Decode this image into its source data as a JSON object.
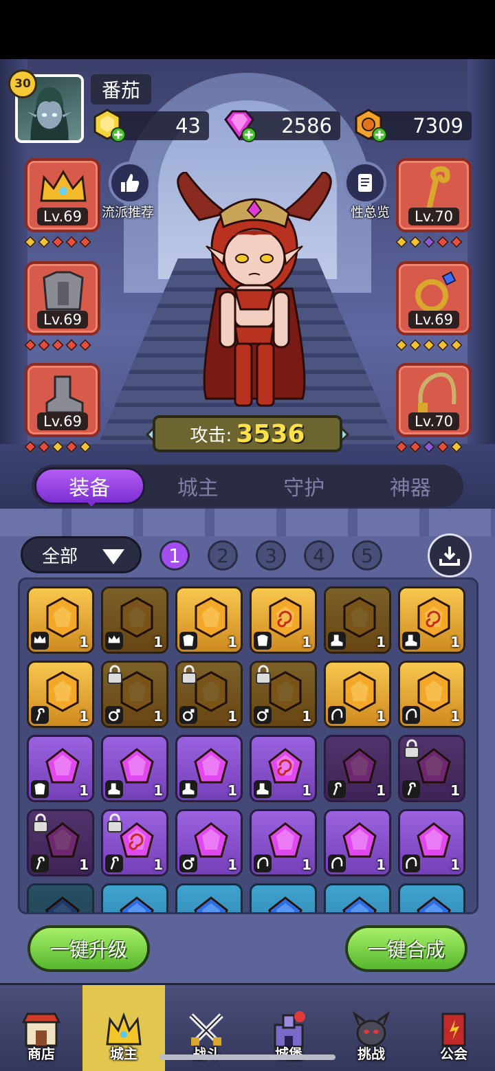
{
  "player": {
    "level": "30",
    "name": "番茄"
  },
  "resources": [
    {
      "name": "gold-hex-currency",
      "value": "43",
      "color": "#f4d33c"
    },
    {
      "name": "pink-gem-currency",
      "value": "2586",
      "color": "#e03ad7"
    },
    {
      "name": "orange-coin-currency",
      "value": "7309",
      "color": "#f0a22a"
    }
  ],
  "slots": {
    "left": [
      {
        "icon": "crown-icon",
        "level": "Lv.69",
        "dots": [
          "#f1c232",
          "#f1c232",
          "#e74c3c",
          "#e74c3c",
          "#e74c3c"
        ]
      },
      {
        "icon": "armor-icon",
        "level": "Lv.69",
        "dots": [
          "#e74c3c",
          "#e74c3c",
          "#e74c3c",
          "#e74c3c",
          "#e74c3c"
        ]
      },
      {
        "icon": "boot-icon",
        "level": "Lv.69",
        "dots": [
          "#e74c3c",
          "#e74c3c",
          "#f1c232",
          "#e74c3c",
          "#f1c232"
        ]
      }
    ],
    "right": [
      {
        "icon": "staff-icon",
        "level": "Lv.70",
        "dots": [
          "#f1c232",
          "#f1c232",
          "#8a5ad6",
          "#e74c3c",
          "#e74c3c"
        ]
      },
      {
        "icon": "ring-icon",
        "level": "Lv.69",
        "dots": [
          "#f1c232",
          "#f1c232",
          "#f1c232",
          "#f1c232",
          "#f1c232"
        ]
      },
      {
        "icon": "whip-icon",
        "level": "Lv.70",
        "dots": [
          "#e74c3c",
          "#e74c3c",
          "#8a5ad6",
          "#e74c3c",
          "#f1c232"
        ]
      }
    ]
  },
  "buttons": {
    "recommend": "流派推荐",
    "overview": "性总览",
    "upgrade_all": "一键升级",
    "merge_all": "一键合成"
  },
  "attack": {
    "label": "攻击:",
    "value": "3536"
  },
  "tabs": [
    "装备",
    "城主",
    "守护",
    "神器"
  ],
  "filter": {
    "label": "全部"
  },
  "pages": [
    "1",
    "2",
    "3",
    "4",
    "5"
  ],
  "grid": [
    [
      {
        "c": "gold",
        "t": "crown",
        "n": "1"
      },
      {
        "c": "gold",
        "t": "crown",
        "n": "1",
        "dim": true
      },
      {
        "c": "gold",
        "t": "armor",
        "n": "1"
      },
      {
        "c": "gold",
        "t": "armor",
        "n": "1",
        "swirl": true
      },
      {
        "c": "gold",
        "t": "boot",
        "n": "1",
        "dim": true
      },
      {
        "c": "gold",
        "t": "boot",
        "n": "1",
        "swirl": true
      }
    ],
    [
      {
        "c": "gold",
        "t": "staff",
        "n": "1"
      },
      {
        "c": "gold",
        "t": "ring",
        "n": "1",
        "dim": true,
        "lock": true
      },
      {
        "c": "gold",
        "t": "ring",
        "n": "1",
        "dim": true,
        "lock": true
      },
      {
        "c": "gold",
        "t": "ring",
        "n": "1",
        "dim": true,
        "lock": true
      },
      {
        "c": "gold",
        "t": "whip",
        "n": "1"
      },
      {
        "c": "gold",
        "t": "whip",
        "n": "1"
      }
    ],
    [
      {
        "c": "purple",
        "t": "armor",
        "n": "1"
      },
      {
        "c": "purple",
        "t": "boot",
        "n": "1"
      },
      {
        "c": "purple",
        "t": "boot",
        "n": "1"
      },
      {
        "c": "purple",
        "t": "boot",
        "n": "1",
        "swirl": true
      },
      {
        "c": "purple",
        "t": "staff",
        "n": "1",
        "dim": true
      },
      {
        "c": "purple",
        "t": "staff",
        "n": "1",
        "dim": true,
        "lock": true
      }
    ],
    [
      {
        "c": "purple",
        "t": "staff",
        "n": "1",
        "dim": true,
        "lock": true
      },
      {
        "c": "purple",
        "t": "staff",
        "n": "1",
        "lock": true,
        "swirl": true
      },
      {
        "c": "purple",
        "t": "ring",
        "n": "1"
      },
      {
        "c": "purple",
        "t": "whip",
        "n": "1"
      },
      {
        "c": "purple",
        "t": "whip",
        "n": "1"
      },
      {
        "c": "purple",
        "t": "whip",
        "n": "1"
      }
    ],
    [
      {
        "c": "blue",
        "t": "",
        "n": "",
        "dim": true
      },
      {
        "c": "blue",
        "t": "",
        "n": ""
      },
      {
        "c": "blue",
        "t": "",
        "n": ""
      },
      {
        "c": "blue",
        "t": "",
        "n": ""
      },
      {
        "c": "blue",
        "t": "",
        "n": ""
      },
      {
        "c": "blue",
        "t": "",
        "n": ""
      }
    ]
  ],
  "nav": [
    {
      "label": "商店",
      "icon": "shop-icon"
    },
    {
      "label": "城主",
      "icon": "crown-icon",
      "active": true
    },
    {
      "label": "战斗",
      "icon": "swords-icon"
    },
    {
      "label": "城堡",
      "icon": "castle-icon"
    },
    {
      "label": "挑战",
      "icon": "demon-icon"
    },
    {
      "label": "公会",
      "icon": "guild-banner-icon"
    }
  ]
}
